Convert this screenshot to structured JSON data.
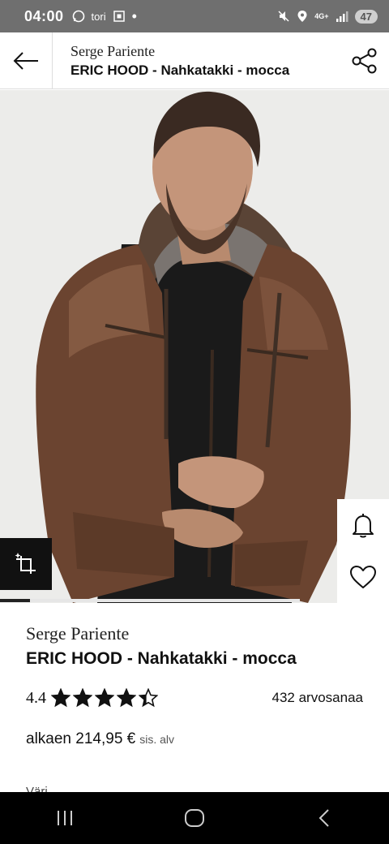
{
  "status_bar": {
    "time": "04:00",
    "left_text": "tori",
    "signal_label": "4G+",
    "battery": "47"
  },
  "header": {
    "brand": "Serge Pariente",
    "product_name": "ERIC HOOD - Nahkatakki - mocca"
  },
  "gallery": {
    "progress": 0.1
  },
  "product": {
    "brand": "Serge Pariente",
    "name": "ERIC HOOD - Nahkatakki - mocca",
    "rating": "4.4",
    "rating_fraction": 0.88,
    "rating_count": "432 arvosanaa",
    "price": "alkaen 214,95 €",
    "vat_note": "sis. alv",
    "cut_text": "Väri"
  },
  "colors": {
    "accent": "#111111",
    "status_bar": "#6f6f6f",
    "jacket": "#6b4430"
  }
}
